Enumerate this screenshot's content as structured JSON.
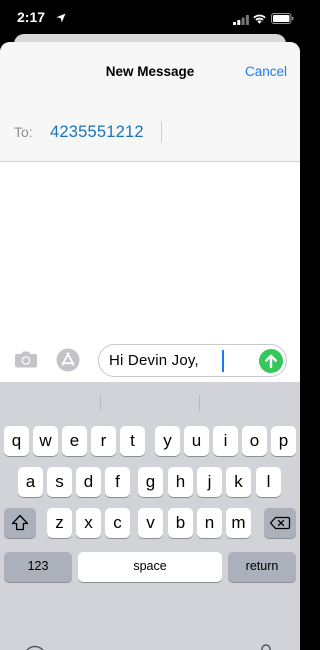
{
  "status_bar": {
    "time": "2:17"
  },
  "nav": {
    "title": "New Message",
    "cancel_label": "Cancel"
  },
  "recipient": {
    "label": "To:",
    "value": "4235551212"
  },
  "composer": {
    "text": "Hi Devin Joy, "
  },
  "keyboard": {
    "row1": [
      "q",
      "w",
      "e",
      "r",
      "t",
      "y",
      "u",
      "i",
      "o",
      "p"
    ],
    "row2": [
      "a",
      "s",
      "d",
      "f",
      "g",
      "h",
      "j",
      "k",
      "l"
    ],
    "row3": [
      "z",
      "x",
      "c",
      "v",
      "b",
      "n",
      "m"
    ],
    "numbers_label": "123",
    "space_label": "space",
    "return_label": "return"
  },
  "colors": {
    "accent": "#1a7cf5",
    "send": "#34c759",
    "recipient": "#1b74b8",
    "keyboard_bg": "#d1d3d9"
  }
}
